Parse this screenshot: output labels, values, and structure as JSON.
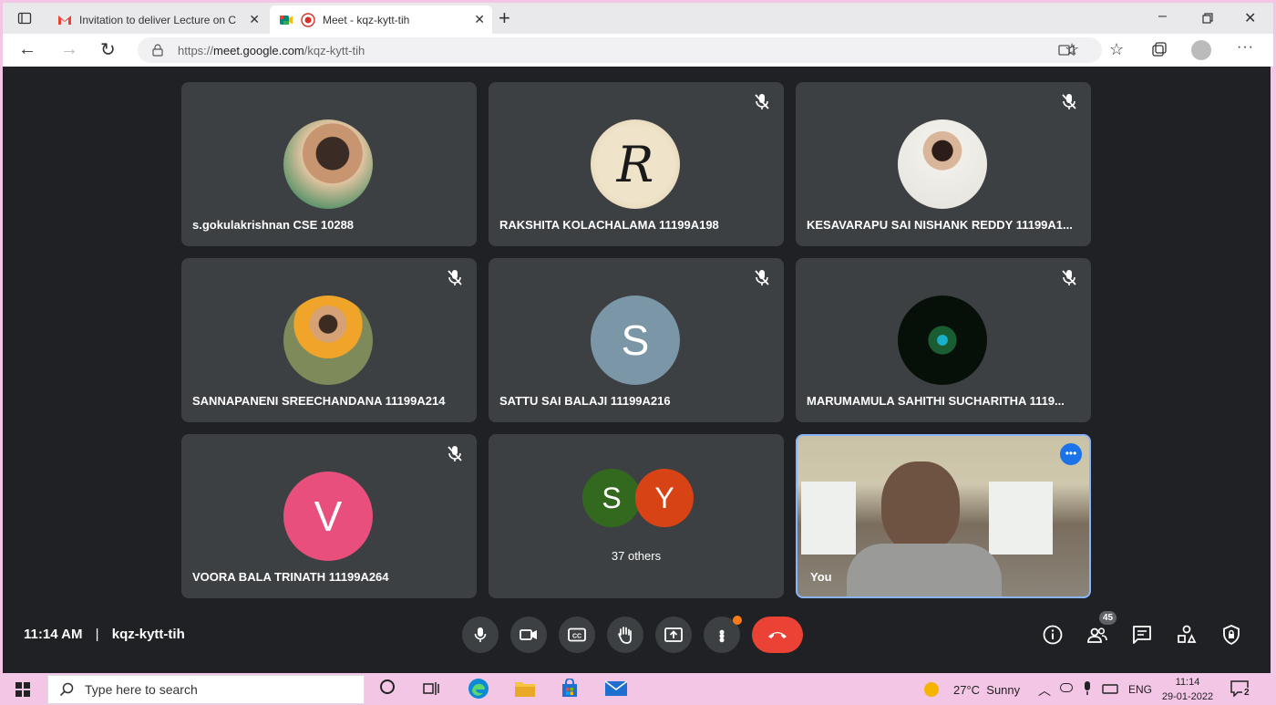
{
  "browser": {
    "tabs": [
      {
        "title": "Invitation to deliver Lecture on C",
        "icon": "gmail-icon"
      },
      {
        "title": "Meet - kqz-kytt-tih",
        "icon": "meet-icon"
      }
    ],
    "url_prefix": "https://",
    "url_domain": "meet.google.com",
    "url_path": "/kqz-kytt-tih"
  },
  "meet": {
    "participants": [
      {
        "name": "s.gokulakrishnan CSE 10288",
        "avatar": "photo",
        "muted": false
      },
      {
        "name": "RAKSHITA KOLACHALAMA 11199A198",
        "avatar": "photo",
        "muted": true
      },
      {
        "name": "KESAVARAPU SAI NISHANK REDDY 11199A1...",
        "avatar": "photo",
        "muted": true
      },
      {
        "name": "SANNAPANENI SREECHANDANA 11199A214",
        "avatar": "photo",
        "muted": true
      },
      {
        "name": "SATTU SAI BALAJI 11199A216",
        "avatar": "letter",
        "letter": "S",
        "color": "#7b96a6",
        "muted": true
      },
      {
        "name": "MARUMAMULA SAHITHI SUCHARITHA 1119...",
        "avatar": "photo",
        "muted": true
      },
      {
        "name": "VOORA BALA TRINATH 11199A264",
        "avatar": "letter",
        "letter": "V",
        "color": "#e94f7c",
        "muted": true
      }
    ],
    "others": {
      "letters": [
        "S",
        "Y"
      ],
      "colors": [
        "#33691e",
        "#d84315"
      ],
      "label": "37 others"
    },
    "self_label": "You",
    "time": "11:14 AM",
    "separator": "|",
    "meeting_code": "kqz-kytt-tih",
    "people_count": "45",
    "end_call_color": "#ea4335"
  },
  "taskbar": {
    "search_placeholder": "Type here to search",
    "weather": "27°C  Sunny",
    "lang": "ENG",
    "time": "11:14",
    "date": "29-01-2022",
    "notifications": "2"
  }
}
